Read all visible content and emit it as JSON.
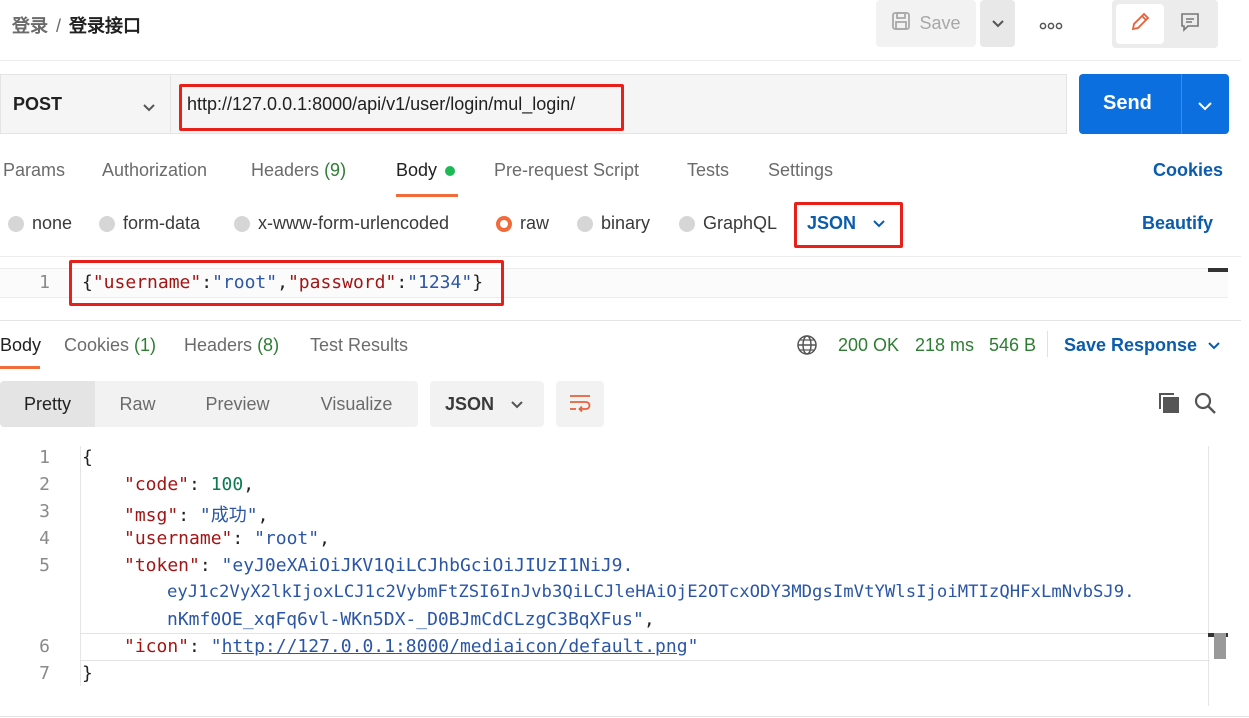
{
  "header": {
    "breadcrumb_parent": "登录",
    "breadcrumb_sep": "/",
    "breadcrumb_current": "登录接口",
    "save_label": "Save"
  },
  "request": {
    "method": "POST",
    "url": "http://127.0.0.1:8000/api/v1/user/login/mul_login/",
    "send_label": "Send"
  },
  "request_tabs": [
    {
      "label": "Params"
    },
    {
      "label": "Authorization"
    },
    {
      "label": "Headers",
      "count": "(9)"
    },
    {
      "label": "Body"
    },
    {
      "label": "Pre-request Script"
    },
    {
      "label": "Tests"
    },
    {
      "label": "Settings"
    }
  ],
  "cookies_label": "Cookies",
  "body_types": [
    "none",
    "form-data",
    "x-www-form-urlencoded",
    "raw",
    "binary",
    "GraphQL"
  ],
  "body_selected": "raw",
  "body_format": "JSON",
  "beautify_label": "Beautify",
  "request_body": {
    "line": "1",
    "open": "{",
    "k1": "\"username\"",
    "colon": ":",
    "v1": "\"root\"",
    "comma": ",",
    "k2": "\"password\"",
    "v2": "\"1234\"",
    "close": "}"
  },
  "response_tabs": [
    {
      "label": "Body"
    },
    {
      "label": "Cookies",
      "count": "(1)"
    },
    {
      "label": "Headers",
      "count": "(8)"
    },
    {
      "label": "Test Results"
    }
  ],
  "response_status": {
    "status": "200 OK",
    "time": "218 ms",
    "size": "546 B",
    "save_response": "Save Response"
  },
  "view_modes": [
    "Pretty",
    "Raw",
    "Preview",
    "Visualize"
  ],
  "response_format": "JSON",
  "response_body": {
    "line_numbers": [
      "1",
      "2",
      "3",
      "4",
      "5",
      "6",
      "7"
    ],
    "open": "{",
    "code_key": "\"code\"",
    "code_val": "100",
    "msg_key": "\"msg\"",
    "msg_val": "\"成功\"",
    "username_key": "\"username\"",
    "username_val": "\"root\"",
    "token_key": "\"token\"",
    "token_val_1": "\"eyJ0eXAiOiJKV1QiLCJhbGciOiJIUzI1NiJ9.",
    "token_val_2": "eyJ1c2VyX2lkIjoxLCJ1c2VybmFtZSI6InJvb3QiLCJleHAiOjE2OTcxODY3MDgsImVtYWlsIjoiMTIzQHFxLmNvbSJ9.",
    "token_val_3": "nKmf0OE_xqFq6vl-WKn5DX-_D0BJmCdCLzgC3BqXFus\"",
    "icon_key": "\"icon\"",
    "icon_q1": "\"",
    "icon_url": "http://127.0.0.1:8000/mediaicon/default.png",
    "icon_q2": "\"",
    "close": "}"
  }
}
